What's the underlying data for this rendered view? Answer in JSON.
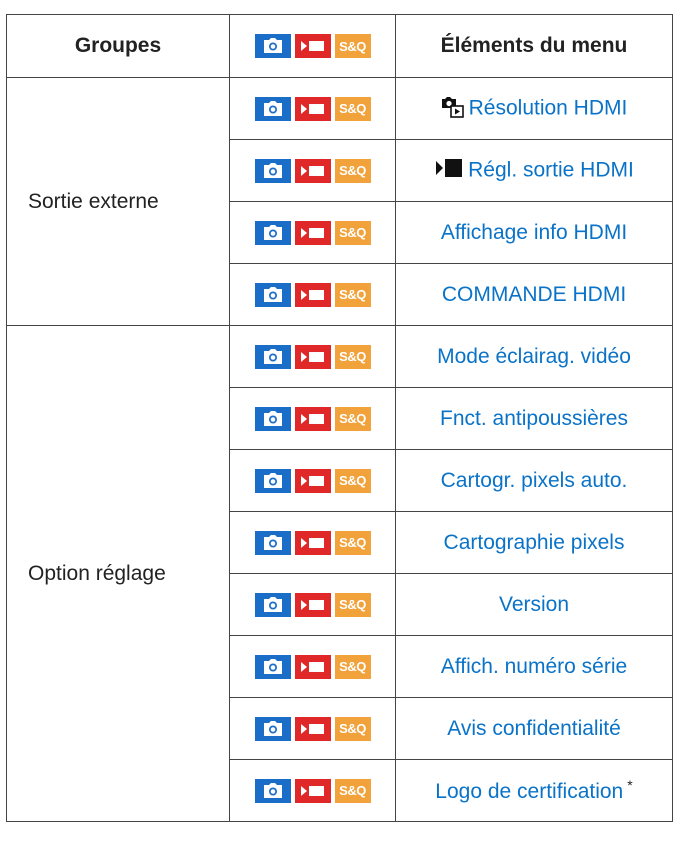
{
  "table": {
    "headers": {
      "groups": "Groupes",
      "items": "Éléments du menu"
    },
    "mode_badges": {
      "photo": "photo-mode-icon",
      "movie": "movie-mode-icon",
      "sq": "S&Q"
    },
    "colors": {
      "photo": "#1a6ec8",
      "movie": "#e02828",
      "sq": "#f2a23a",
      "link": "#0a73c8"
    },
    "groups": [
      {
        "label": "Sortie externe",
        "items": [
          {
            "label": "Résolution HDMI",
            "icon": "playback-camera-icon"
          },
          {
            "label": "Régl. sortie HDMI",
            "icon": "movie-record-icon"
          },
          {
            "label": "Affichage info HDMI"
          },
          {
            "label": "COMMANDE HDMI"
          }
        ]
      },
      {
        "label": "Option réglage",
        "items": [
          {
            "label": "Mode éclairag. vidéo"
          },
          {
            "label": "Fnct. antipoussières"
          },
          {
            "label": "Cartogr. pixels auto."
          },
          {
            "label": "Cartographie pixels"
          },
          {
            "label": "Version"
          },
          {
            "label": "Affich. numéro série"
          },
          {
            "label": "Avis confidentialité"
          },
          {
            "label": "Logo de certification",
            "footnote": "*"
          }
        ]
      }
    ]
  }
}
